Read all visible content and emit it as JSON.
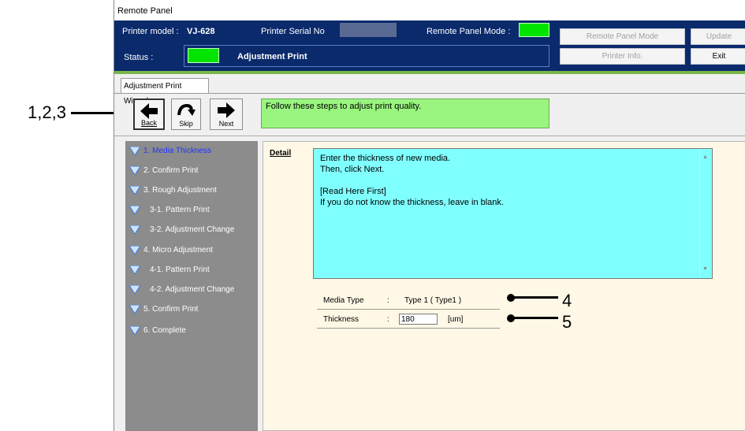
{
  "window": {
    "title": "Remote Panel"
  },
  "header": {
    "printer_model_label": "Printer model :",
    "printer_model_value": "VJ-628",
    "serial_label": "Printer Serial No",
    "remote_mode_label": "Remote Panel Mode :",
    "status_label": "Status :",
    "status_value": "Adjustment Print",
    "indicator_color": "#00e400"
  },
  "buttons": {
    "remote_panel_mode": "Remote Panel Mode",
    "update": "Update",
    "printer_info": "Printer Info.",
    "exit": "Exit"
  },
  "tab": {
    "label": "Adjustment Print Wizard"
  },
  "nav": {
    "back": "Back",
    "skip": "Skip",
    "next": "Next"
  },
  "message": "Follow these steps to adjust print quality.",
  "steps": [
    {
      "label": "1. Media Thickness",
      "active": true
    },
    {
      "label": "2. Confirm Print"
    },
    {
      "label": "3. Rough Adjustment"
    },
    {
      "label": "3-1.  Pattern Print"
    },
    {
      "label": "3-2.  Adjustment Change"
    },
    {
      "label": "4. Micro Adjustment"
    },
    {
      "label": "4-1.  Pattern Print"
    },
    {
      "label": "4-2.  Adjustment Change"
    },
    {
      "label": "5. Confirm Print"
    },
    {
      "label": "6. Complete"
    }
  ],
  "detail": {
    "label": "Detail",
    "lines": [
      "Enter the thickness of new media.",
      "Then, click Next.",
      "",
      "[Read Here First]",
      "If you do not know the thickness, leave in blank."
    ]
  },
  "form": {
    "media_type_label": "Media Type",
    "media_type_value": "Type 1 ( Type1 )",
    "thickness_label": "Thickness",
    "thickness_value": "180",
    "thickness_unit": "[um]",
    "colon": ":"
  },
  "callouts": {
    "nav": "1,2,3",
    "media_type": "4",
    "thickness": "5"
  }
}
